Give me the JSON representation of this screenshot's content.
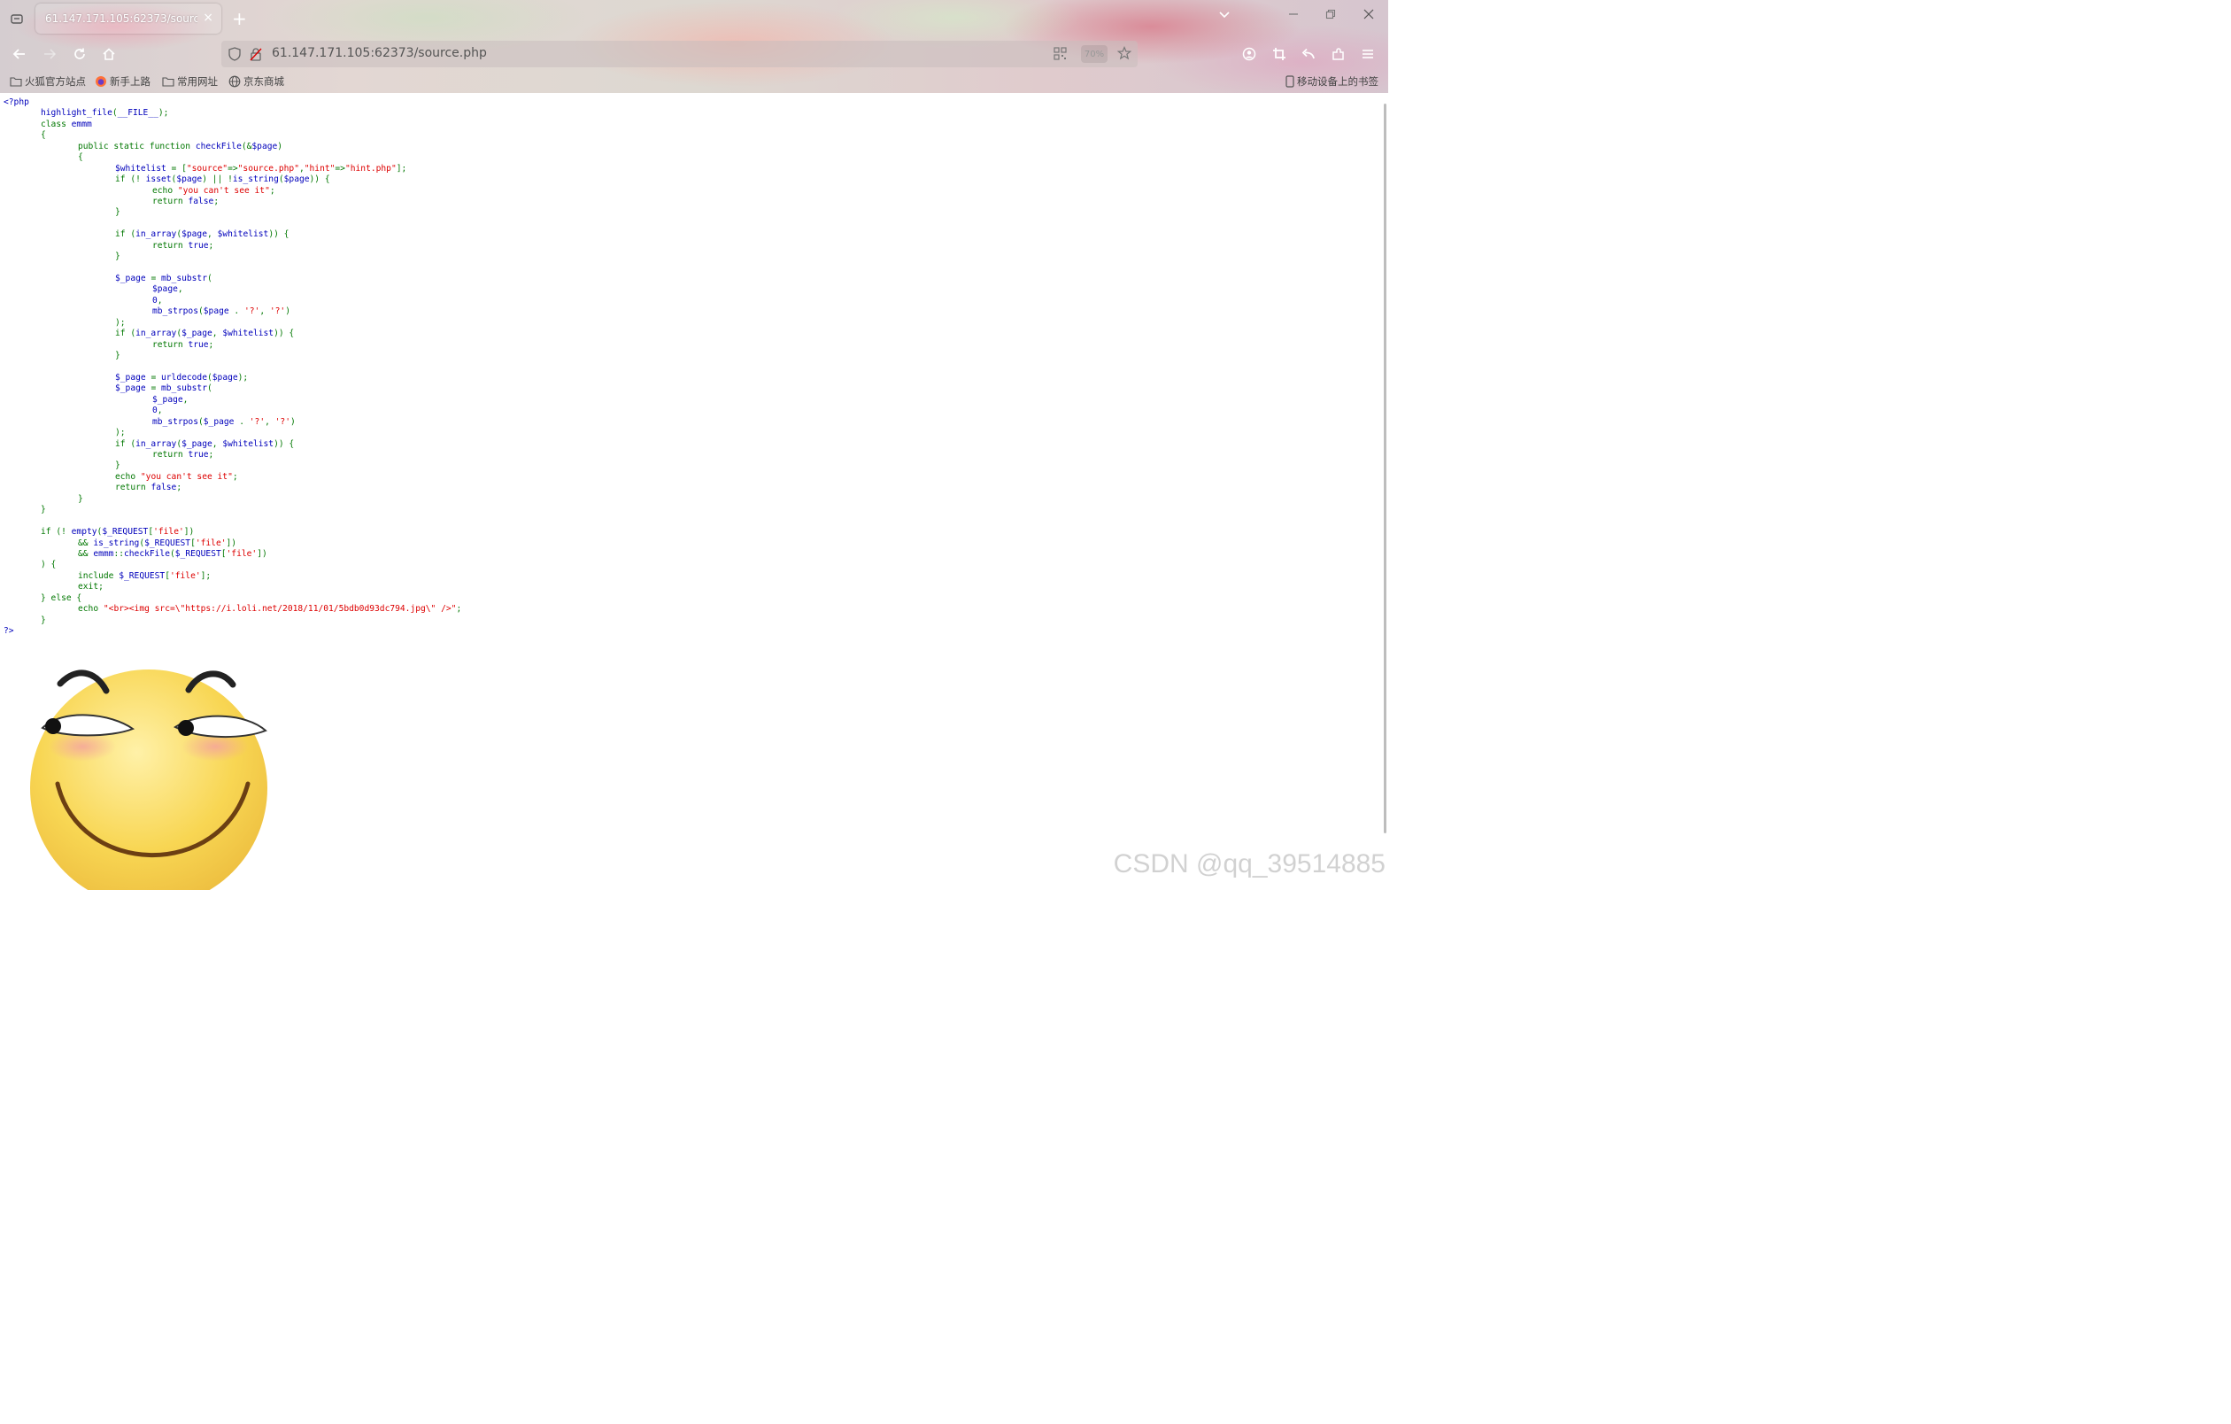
{
  "browser": {
    "tab_title": "61.147.171.105:62373/source.php",
    "tab_close": "×",
    "new_tab": "+",
    "url": "61.147.171.105:62373/source.php",
    "zoom_level": "70%",
    "bookmarks": [
      {
        "label": "火狐官方站点",
        "icon": "folder-icon"
      },
      {
        "label": "新手上路",
        "icon": "firefox-icon"
      },
      {
        "label": "常用网址",
        "icon": "folder-icon"
      },
      {
        "label": "京东商城",
        "icon": "globe-icon"
      }
    ],
    "mobile_bookmarks": "移动设备上的书签"
  },
  "source_code": [
    [
      [
        "d",
        "<?php"
      ]
    ],
    [
      [
        "d",
        "highlight_file"
      ],
      [
        "k",
        "("
      ],
      [
        "d",
        "__FILE__"
      ],
      [
        "k",
        ");"
      ]
    ],
    [
      [
        "k",
        "class "
      ],
      [
        "d",
        "emmm"
      ]
    ],
    [
      [
        "k",
        "{"
      ]
    ],
    [
      [
        "k",
        "public static function "
      ],
      [
        "d",
        "checkFile"
      ],
      [
        "k",
        "(&"
      ],
      [
        "d",
        "$page"
      ],
      [
        "k",
        ")"
      ]
    ],
    [
      [
        "k",
        "{"
      ]
    ],
    [
      [
        "d",
        "$whitelist "
      ],
      [
        "k",
        "= ["
      ],
      [
        "s",
        "\"source\""
      ],
      [
        "k",
        "=>"
      ],
      [
        "s",
        "\"source.php\""
      ],
      [
        "k",
        ","
      ],
      [
        "s",
        "\"hint\""
      ],
      [
        "k",
        "=>"
      ],
      [
        "s",
        "\"hint.php\""
      ],
      [
        "k",
        "];"
      ]
    ],
    [
      [
        "k",
        "if (! "
      ],
      [
        "d",
        "isset"
      ],
      [
        "k",
        "("
      ],
      [
        "d",
        "$page"
      ],
      [
        "k",
        ") || !"
      ],
      [
        "d",
        "is_string"
      ],
      [
        "k",
        "("
      ],
      [
        "d",
        "$page"
      ],
      [
        "k",
        ")) {"
      ]
    ],
    [
      [
        "k",
        "echo "
      ],
      [
        "s",
        "\"you can't see it\""
      ],
      [
        "k",
        ";"
      ]
    ],
    [
      [
        "k",
        "return "
      ],
      [
        "d",
        "false"
      ],
      [
        "k",
        ";"
      ]
    ],
    [
      [
        "k",
        "}"
      ]
    ],
    [],
    [
      [
        "k",
        "if ("
      ],
      [
        "d",
        "in_array"
      ],
      [
        "k",
        "("
      ],
      [
        "d",
        "$page"
      ],
      [
        "k",
        ", "
      ],
      [
        "d",
        "$whitelist"
      ],
      [
        "k",
        ")) {"
      ]
    ],
    [
      [
        "k",
        "return "
      ],
      [
        "d",
        "true"
      ],
      [
        "k",
        ";"
      ]
    ],
    [
      [
        "k",
        "}"
      ]
    ],
    [],
    [
      [
        "d",
        "$_page "
      ],
      [
        "k",
        "= "
      ],
      [
        "d",
        "mb_substr"
      ],
      [
        "k",
        "("
      ]
    ],
    [
      [
        "d",
        "$page"
      ],
      [
        "k",
        ","
      ]
    ],
    [
      [
        "d",
        "0"
      ],
      [
        "k",
        ","
      ]
    ],
    [
      [
        "d",
        "mb_strpos"
      ],
      [
        "k",
        "("
      ],
      [
        "d",
        "$page "
      ],
      [
        "k",
        ". "
      ],
      [
        "s",
        "'?'"
      ],
      [
        "k",
        ", "
      ],
      [
        "s",
        "'?'"
      ],
      [
        "k",
        ")"
      ]
    ],
    [
      [
        "k",
        ");"
      ]
    ],
    [
      [
        "k",
        "if ("
      ],
      [
        "d",
        "in_array"
      ],
      [
        "k",
        "("
      ],
      [
        "d",
        "$_page"
      ],
      [
        "k",
        ", "
      ],
      [
        "d",
        "$whitelist"
      ],
      [
        "k",
        ")) {"
      ]
    ],
    [
      [
        "k",
        "return "
      ],
      [
        "d",
        "true"
      ],
      [
        "k",
        ";"
      ]
    ],
    [
      [
        "k",
        "}"
      ]
    ],
    [],
    [
      [
        "d",
        "$_page "
      ],
      [
        "k",
        "= "
      ],
      [
        "d",
        "urldecode"
      ],
      [
        "k",
        "("
      ],
      [
        "d",
        "$page"
      ],
      [
        "k",
        ");"
      ]
    ],
    [
      [
        "d",
        "$_page "
      ],
      [
        "k",
        "= "
      ],
      [
        "d",
        "mb_substr"
      ],
      [
        "k",
        "("
      ]
    ],
    [
      [
        "d",
        "$_page"
      ],
      [
        "k",
        ","
      ]
    ],
    [
      [
        "d",
        "0"
      ],
      [
        "k",
        ","
      ]
    ],
    [
      [
        "d",
        "mb_strpos"
      ],
      [
        "k",
        "("
      ],
      [
        "d",
        "$_page "
      ],
      [
        "k",
        ". "
      ],
      [
        "s",
        "'?'"
      ],
      [
        "k",
        ", "
      ],
      [
        "s",
        "'?'"
      ],
      [
        "k",
        ")"
      ]
    ],
    [
      [
        "k",
        ");"
      ]
    ],
    [
      [
        "k",
        "if ("
      ],
      [
        "d",
        "in_array"
      ],
      [
        "k",
        "("
      ],
      [
        "d",
        "$_page"
      ],
      [
        "k",
        ", "
      ],
      [
        "d",
        "$whitelist"
      ],
      [
        "k",
        ")) {"
      ]
    ],
    [
      [
        "k",
        "return "
      ],
      [
        "d",
        "true"
      ],
      [
        "k",
        ";"
      ]
    ],
    [
      [
        "k",
        "}"
      ]
    ],
    [
      [
        "k",
        "echo "
      ],
      [
        "s",
        "\"you can't see it\""
      ],
      [
        "k",
        ";"
      ]
    ],
    [
      [
        "k",
        "return "
      ],
      [
        "d",
        "false"
      ],
      [
        "k",
        ";"
      ]
    ],
    [
      [
        "k",
        "}"
      ]
    ],
    [
      [
        "k",
        "}"
      ]
    ],
    [],
    [
      [
        "k",
        "if (! "
      ],
      [
        "d",
        "empty"
      ],
      [
        "k",
        "("
      ],
      [
        "d",
        "$_REQUEST"
      ],
      [
        "k",
        "["
      ],
      [
        "s",
        "'file'"
      ],
      [
        "k",
        "])"
      ]
    ],
    [
      [
        "k",
        "&& "
      ],
      [
        "d",
        "is_string"
      ],
      [
        "k",
        "("
      ],
      [
        "d",
        "$_REQUEST"
      ],
      [
        "k",
        "["
      ],
      [
        "s",
        "'file'"
      ],
      [
        "k",
        "])"
      ]
    ],
    [
      [
        "k",
        "&& "
      ],
      [
        "d",
        "emmm"
      ],
      [
        "k",
        "::"
      ],
      [
        "d",
        "checkFile"
      ],
      [
        "k",
        "("
      ],
      [
        "d",
        "$_REQUEST"
      ],
      [
        "k",
        "["
      ],
      [
        "s",
        "'file'"
      ],
      [
        "k",
        "])"
      ]
    ],
    [
      [
        "k",
        ") {"
      ]
    ],
    [
      [
        "k",
        "include "
      ],
      [
        "d",
        "$_REQUEST"
      ],
      [
        "k",
        "["
      ],
      [
        "s",
        "'file'"
      ],
      [
        "k",
        "];"
      ]
    ],
    [
      [
        "k",
        "exit;"
      ]
    ],
    [
      [
        "k",
        "} else {"
      ]
    ],
    [
      [
        "k",
        "echo "
      ],
      [
        "s",
        "\"<br><img src=\\\"https://i.loli.net/2018/11/01/5bdb0d93dc794.jpg\\\" />\""
      ],
      [
        "k",
        ";"
      ]
    ],
    [
      [
        "k",
        "}"
      ]
    ],
    [
      [
        "d",
        "?>"
      ]
    ]
  ],
  "watermark": "CSDN @qq_39514885",
  "colors": {
    "keyword": "#007700",
    "default": "#0000bb",
    "string": "#dd0000"
  }
}
